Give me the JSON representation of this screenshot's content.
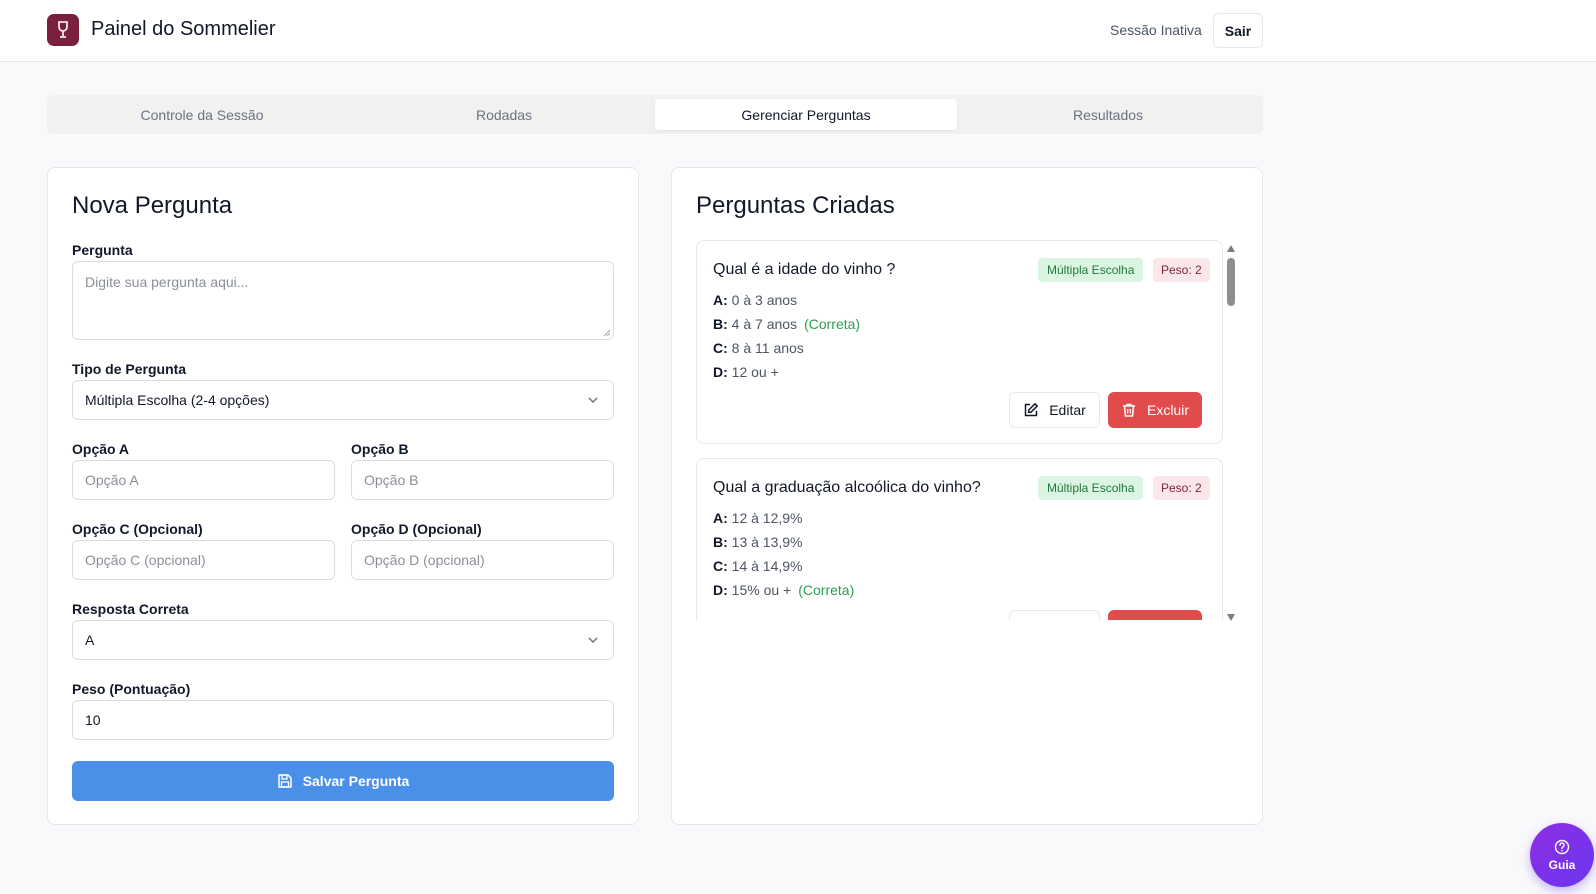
{
  "header": {
    "title": "Painel do Sommelier",
    "session_status": "Sessão Inativa",
    "logout_label": "Sair",
    "logo_icon": "wine-glass-icon"
  },
  "tabs": [
    {
      "label": "Controle da Sessão",
      "active": false
    },
    {
      "label": "Rodadas",
      "active": false
    },
    {
      "label": "Gerenciar Perguntas",
      "active": true
    },
    {
      "label": "Resultados",
      "active": false
    }
  ],
  "form": {
    "title": "Nova Pergunta",
    "question_label": "Pergunta",
    "question_placeholder": "Digite sua pergunta aqui...",
    "type_label": "Tipo de Pergunta",
    "type_value": "Múltipla Escolha (2-4 opções)",
    "option_a_label": "Opção A",
    "option_a_placeholder": "Opção A",
    "option_b_label": "Opção B",
    "option_b_placeholder": "Opção B",
    "option_c_label": "Opção C (Opcional)",
    "option_c_placeholder": "Opção C (opcional)",
    "option_d_label": "Opção D (Opcional)",
    "option_d_placeholder": "Opção D (opcional)",
    "correct_label": "Resposta Correta",
    "correct_value": "A",
    "weight_label": "Peso (Pontuação)",
    "weight_value": "10",
    "save_label": "Salvar Pergunta"
  },
  "questions_panel": {
    "title": "Perguntas Criadas",
    "edit_label": "Editar",
    "delete_label": "Excluir",
    "correct_tag": "(Correta)",
    "questions": [
      {
        "title": "Qual é a idade do vinho ?",
        "type": "Múltipla Escolha",
        "weight": "Peso: 2",
        "options": [
          {
            "key": "A:",
            "text": "0 à 3 anos",
            "correct": false
          },
          {
            "key": "B:",
            "text": "4 à 7 anos",
            "correct": true
          },
          {
            "key": "C:",
            "text": "8 à 11 anos",
            "correct": false
          },
          {
            "key": "D:",
            "text": "12 ou +",
            "correct": false
          }
        ]
      },
      {
        "title": "Qual a graduação alcoólica do vinho?",
        "type": "Múltipla Escolha",
        "weight": "Peso: 2",
        "options": [
          {
            "key": "A:",
            "text": "12 à 12,9%",
            "correct": false
          },
          {
            "key": "B:",
            "text": "13 à 13,9%",
            "correct": false
          },
          {
            "key": "C:",
            "text": "14 à 14,9%",
            "correct": false
          },
          {
            "key": "D:",
            "text": "15% ou +",
            "correct": true
          }
        ]
      }
    ]
  },
  "guide": {
    "label": "Guia"
  },
  "colors": {
    "brand": "#7a1f3d",
    "primary": "#4a90e9",
    "danger": "#e24b4b",
    "success": "#2e9e52",
    "guide": "#7b34e8"
  }
}
